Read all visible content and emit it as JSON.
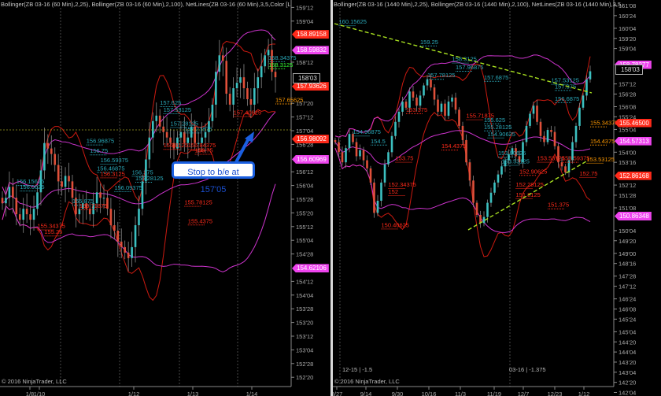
{
  "colors": {
    "bull": "#3cc0c0",
    "bear": "#e0503a",
    "wick": "#888888",
    "bb25": "#cc1a10",
    "bb100": "#cc33cc",
    "trend": "#a8e020",
    "cyan_label": "#2aa8b8",
    "red_label": "#ff2a1a",
    "green_label": "#33ff33",
    "orange_label": "#ff9900"
  },
  "left": {
    "header": "Bollinger(ZB 03-16 (60 Min),2,25), Bollinger(ZB 03-16 (60 Min),2,100), NetLines(ZB 03-16 (60 Min),3,5,Color [Lime],C",
    "copyright": "© 2016 NinjaTrader, LLC",
    "annotation": "Stop to b/e at 157'05",
    "price_axis": {
      "ticks": [
        "159'12",
        "159'04",
        "158'12",
        "157'20",
        "157'12",
        "157'04",
        "156'28",
        "156'12",
        "156'04",
        "155'28",
        "155'20",
        "155'12",
        "155'04",
        "154'28",
        "154'12",
        "154'04",
        "153'28",
        "153'20",
        "153'12",
        "153'04",
        "152'28",
        "152'20"
      ]
    },
    "date_axis": [
      "1/8",
      "1/10",
      "1/12",
      "1/13",
      "1/14"
    ],
    "tags": [
      {
        "text": "158.89158",
        "type": "red",
        "price": 158.89
      },
      {
        "text": "158.59832",
        "type": "mag",
        "price": 158.6
      },
      {
        "text": "157.93626",
        "type": "red",
        "price": 157.94
      },
      {
        "text": "156.98092",
        "type": "red",
        "price": 156.98
      },
      {
        "text": "156.60969",
        "type": "mag",
        "price": 156.61
      },
      {
        "text": "154.62106",
        "type": "mag",
        "price": 154.62
      }
    ],
    "current_price": "158'03"
  },
  "right": {
    "header": "Bollinger(ZB 03-16 (1440 Min),2,25), Bollinger(ZB 03-16 (1440 Min),2,100), NetLines(ZB 03-16 (1440 Min),3,5,Color",
    "copyright": "© 2016 NinjaTrader, LLC",
    "contract_labels": [
      "12-15 | -1.5",
      "03-16 | -1.375"
    ],
    "price_axis": {
      "ticks": [
        "161'08",
        "160'24",
        "160'04",
        "159'20",
        "159'04",
        "157'12",
        "156'28",
        "156'08",
        "155'24",
        "155'04",
        "154'00",
        "153'16",
        "152'12",
        "151'28",
        "151'08",
        "150'04",
        "149'20",
        "149'00",
        "148'16",
        "147'28",
        "147'12",
        "146'24",
        "146'08",
        "145'24",
        "145'04",
        "144'20",
        "144'04",
        "143'20",
        "143'04",
        "142'20",
        "142'04"
      ]
    },
    "date_axis": [
      "8/27",
      "9/14",
      "9/30",
      "10/16",
      "11/3",
      "11/19",
      "12/7",
      "12/23",
      "1/12"
    ],
    "tags": [
      {
        "text": "158.78277",
        "type": "mag",
        "price": 158.35
      },
      {
        "text": "155.46500",
        "type": "red",
        "price": 155.47
      },
      {
        "text": "154.57313",
        "type": "mag",
        "price": 154.57
      },
      {
        "text": "152.86168",
        "type": "red",
        "price": 152.86
      },
      {
        "text": "150.86348",
        "type": "mag",
        "price": 150.86
      }
    ],
    "current_price": "158'03"
  },
  "chart_data": [
    {
      "type": "candlestick",
      "title": "ZB 03-16 (60 Min)",
      "closes": [
        155.8,
        155.9,
        156.1,
        155.9,
        155.6,
        155.5,
        155.7,
        155.6,
        155.5,
        155.7,
        156.0,
        156.4,
        156.9,
        156.8,
        156.7,
        156.5,
        156.2,
        156.1,
        156.3,
        156.2,
        155.9,
        155.6,
        155.7,
        155.8,
        155.7,
        155.6,
        155.8,
        156.0,
        155.9,
        155.9,
        155.7,
        155.4,
        155.3,
        155.1,
        155.0,
        154.9,
        154.8,
        155.0,
        155.4,
        155.7,
        156.2,
        156.6,
        157.0,
        157.3,
        157.4,
        157.2,
        157.1,
        157.0,
        156.9,
        156.8,
        157.0,
        157.1,
        156.9,
        157.0,
        157.2,
        156.9,
        156.9,
        157.0,
        157.1,
        157.3,
        157.6,
        158.2,
        158.5,
        158.4,
        157.8,
        157.6,
        157.9,
        158.0,
        158.1,
        157.9,
        157.7,
        157.6,
        157.9,
        158.1,
        158.3,
        158.5,
        158.6,
        158.2,
        158.1
      ],
      "labels": [
        {
          "t": "156.15625",
          "c": "cyan",
          "i": 4,
          "p": 156.16
        },
        {
          "t": "156.0625",
          "c": "cyan",
          "i": 5,
          "p": 156.06
        },
        {
          "t": "156.96875",
          "c": "cyan",
          "i": 24,
          "p": 156.9
        },
        {
          "t": "156.75",
          "c": "cyan",
          "i": 25,
          "p": 156.72
        },
        {
          "t": "156.59375",
          "c": "cyan",
          "i": 28,
          "p": 156.55
        },
        {
          "t": "156.46875",
          "c": "cyan",
          "i": 27,
          "p": 156.4
        },
        {
          "t": "156.375",
          "c": "cyan",
          "i": 37,
          "p": 156.33
        },
        {
          "t": "156.28125",
          "c": "cyan",
          "i": 38,
          "p": 156.22
        },
        {
          "t": "156.09375",
          "c": "cyan",
          "i": 32,
          "p": 156.05
        },
        {
          "t": "155.875",
          "c": "cyan",
          "i": 20,
          "p": 155.8
        },
        {
          "t": "157.625",
          "c": "cyan",
          "i": 45,
          "p": 157.6
        },
        {
          "t": "157.53125",
          "c": "cyan",
          "i": 46,
          "p": 157.47
        },
        {
          "t": "157.28125",
          "c": "cyan",
          "i": 48,
          "p": 157.22
        },
        {
          "t": "157.21875",
          "c": "cyan",
          "i": 52,
          "p": 157.12
        },
        {
          "t": "158.34375",
          "c": "cyan",
          "i": 76,
          "p": 158.42
        },
        {
          "t": "156.3125",
          "c": "red",
          "i": 28,
          "p": 156.3
        },
        {
          "t": "155.71875",
          "c": "red",
          "i": 22,
          "p": 155.72
        },
        {
          "t": "155.34375",
          "c": "red",
          "i": 10,
          "p": 155.35
        },
        {
          "t": "155.25",
          "c": "red",
          "i": 12,
          "p": 155.24
        },
        {
          "t": "155.78125",
          "c": "red",
          "i": 52,
          "p": 155.78
        },
        {
          "t": "155.4375",
          "c": "red",
          "i": 53,
          "p": 155.44
        },
        {
          "t": "156.8125",
          "c": "red",
          "i": 46,
          "p": 156.82
        },
        {
          "t": "156.84375",
          "c": "red",
          "i": 53,
          "p": 156.82
        },
        {
          "t": "156.75",
          "c": "red",
          "i": 55,
          "p": 156.73
        },
        {
          "t": "157.40625",
          "c": "red",
          "i": 66,
          "p": 157.42
        },
        {
          "t": "158.3125",
          "c": "green",
          "i": 76,
          "p": 158.29
        },
        {
          "t": "157.65625",
          "c": "orange",
          "i": 82,
          "p": 157.65
        }
      ]
    },
    {
      "type": "candlestick",
      "title": "ZB 03-16 (1440 Min)",
      "closes": [
        154.5,
        154.0,
        153.5,
        154.2,
        154.9,
        154.5,
        153.8,
        154.1,
        153.6,
        153.2,
        152.5,
        151.0,
        151.6,
        152.5,
        153.4,
        154.0,
        154.8,
        155.5,
        156.0,
        156.5,
        156.2,
        157.0,
        156.7,
        156.3,
        156.8,
        157.3,
        157.6,
        157.2,
        156.6,
        156.0,
        156.4,
        155.8,
        156.5,
        156.7,
        156.1,
        155.3,
        154.6,
        153.5,
        152.6,
        151.5,
        150.9,
        150.5,
        150.8,
        151.5,
        152.0,
        152.5,
        152.9,
        153.3,
        153.6,
        153.9,
        154.2,
        153.8,
        153.5,
        154.5,
        155.3,
        155.9,
        156.3,
        155.5,
        154.8,
        154.5,
        155.1,
        155.0,
        154.3,
        153.5,
        153.3,
        153.0,
        153.6,
        154.5,
        155.3,
        156.2,
        156.8,
        157.6,
        158.0
      ],
      "labels": [
        {
          "t": "160.15625",
          "c": "cyan",
          "i": 1,
          "p": 160.35
        },
        {
          "t": "159.25",
          "c": "cyan",
          "i": 24,
          "p": 159.35
        },
        {
          "t": "158.3125",
          "c": "cyan",
          "i": 33,
          "p": 158.5
        },
        {
          "t": "157.96875",
          "c": "cyan",
          "i": 34,
          "p": 158.1
        },
        {
          "t": "157.78125",
          "c": "cyan",
          "i": 26,
          "p": 157.7
        },
        {
          "t": "157.6875",
          "c": "cyan",
          "i": 42,
          "p": 157.6
        },
        {
          "t": "154.96875",
          "c": "cyan",
          "i": 5,
          "p": 154.9
        },
        {
          "t": "154.5",
          "c": "cyan",
          "i": 10,
          "p": 154.45
        },
        {
          "t": "155.625",
          "c": "cyan",
          "i": 42,
          "p": 155.5
        },
        {
          "t": "155.28125",
          "c": "cyan",
          "i": 42,
          "p": 155.15
        },
        {
          "t": "154.90625",
          "c": "cyan",
          "i": 43,
          "p": 154.8
        },
        {
          "t": "153.90625",
          "c": "cyan",
          "i": 46,
          "p": 153.85
        },
        {
          "t": "153.53125",
          "c": "cyan",
          "i": 47,
          "p": 153.45
        },
        {
          "t": "157.53125",
          "c": "cyan",
          "i": 61,
          "p": 157.45
        },
        {
          "t": "157.375",
          "c": "cyan",
          "i": 62,
          "p": 157.15
        },
        {
          "t": "156.6875",
          "c": "cyan",
          "i": 62,
          "p": 156.55
        },
        {
          "t": "153.375",
          "c": "red",
          "i": 20,
          "p": 156.0
        },
        {
          "t": "154.4375",
          "c": "red",
          "i": 30,
          "p": 154.2
        },
        {
          "t": "153.75",
          "c": "red",
          "i": 17,
          "p": 153.6
        },
        {
          "t": "152.34375",
          "c": "red",
          "i": 15,
          "p": 152.3
        },
        {
          "t": "152",
          "c": "red",
          "i": 15,
          "p": 151.95
        },
        {
          "t": "150.40625",
          "c": "red",
          "i": 13,
          "p": 150.3
        },
        {
          "t": "155.71875",
          "c": "red",
          "i": 37,
          "p": 155.7
        },
        {
          "t": "152.90625",
          "c": "red",
          "i": 52,
          "p": 152.95
        },
        {
          "t": "152.28125",
          "c": "red",
          "i": 51,
          "p": 152.3
        },
        {
          "t": "151.8125",
          "c": "red",
          "i": 51,
          "p": 151.8
        },
        {
          "t": "151.375",
          "c": "red",
          "i": 60,
          "p": 151.3
        },
        {
          "t": "152.75",
          "c": "red",
          "i": 69,
          "p": 152.85
        },
        {
          "t": "153.53125",
          "c": "red",
          "i": 57,
          "p": 153.6
        },
        {
          "t": "153.59375",
          "c": "red",
          "i": 64,
          "p": 153.6
        },
        {
          "t": "155.34375",
          "c": "orange",
          "i": 73,
          "p": 155.35
        },
        {
          "t": "154.4375",
          "c": "orange",
          "i": 72,
          "p": 154.45
        },
        {
          "t": "153.53125",
          "c": "orange",
          "i": 71,
          "p": 153.55
        }
      ]
    }
  ]
}
